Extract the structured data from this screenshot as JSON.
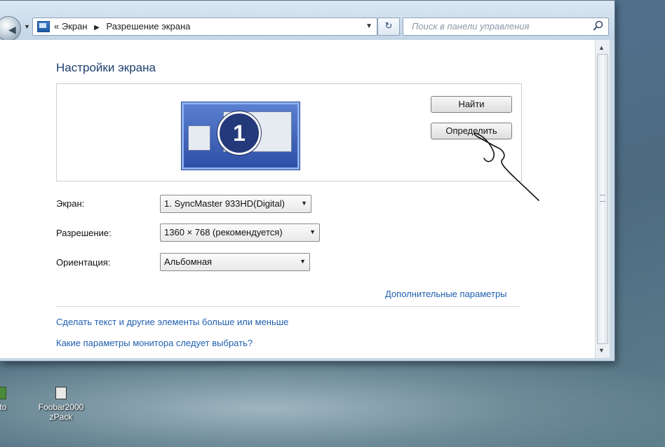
{
  "toolbar": {
    "breadcrumb_prefix": "«",
    "breadcrumb": [
      "Экран",
      "Разрешение экрана"
    ],
    "search_placeholder": "Поиск в панели управления"
  },
  "main": {
    "title": "Настройки экрана",
    "monitor_number": "1",
    "find_button": "Найти",
    "identify_button": "Определить",
    "fields": {
      "display_label": "Экран:",
      "display_value": "1. SyncMaster 933HD(Digital)",
      "resolution_label": "Разрешение:",
      "resolution_value": "1360 × 768 (рекомендуется)",
      "orientation_label": "Ориентация:",
      "orientation_value": "Альбомная"
    },
    "advanced_link": "Дополнительные параметры",
    "links": [
      "Сделать текст и другие элементы больше или меньше",
      "Какие параметры монитора следует выбрать?"
    ]
  },
  "desktop": {
    "icons": [
      {
        "label": "oto"
      },
      {
        "label": "Foobar2000 zPack"
      }
    ]
  }
}
